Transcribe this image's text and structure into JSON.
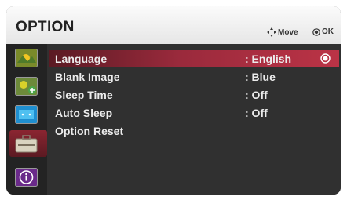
{
  "header": {
    "title": "OPTION",
    "move_label": "Move",
    "ok_label": "OK"
  },
  "sidebar": {
    "items": [
      {
        "icon": "picture-icon"
      },
      {
        "icon": "audio-icon"
      },
      {
        "icon": "screen-icon"
      },
      {
        "icon": "option-toolbox-icon",
        "selected": true
      },
      {
        "icon": "info-icon"
      }
    ]
  },
  "menu": {
    "items": [
      {
        "label": "Language",
        "value": ": English",
        "selected": true
      },
      {
        "label": "Blank Image",
        "value": ": Blue"
      },
      {
        "label": "Sleep Time",
        "value": ": Off"
      },
      {
        "label": "Auto Sleep",
        "value": ": Off"
      },
      {
        "label": "Option Reset",
        "value": ""
      }
    ]
  },
  "colors": {
    "selection": "#9a2a3c",
    "header_bg": "#f2f2f2",
    "panel_bg": "#303030",
    "text": "#ececec"
  }
}
